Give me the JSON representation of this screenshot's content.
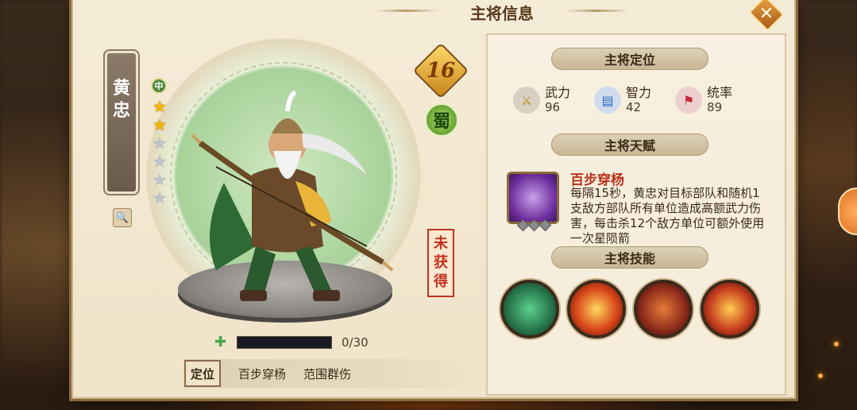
{
  "window": {
    "title": "主将信息"
  },
  "hero": {
    "name_chars": [
      "黄",
      "忠"
    ],
    "rank": "中",
    "stars_total": 6,
    "stars_filled": 2,
    "level": "16",
    "faction": "蜀",
    "status_chars": [
      "未",
      "获",
      "得"
    ],
    "fragments": {
      "current": 0,
      "max": 30,
      "text": "0/30"
    }
  },
  "tags": {
    "label": "定位",
    "items": [
      "百步穿杨",
      "范围群伤"
    ]
  },
  "sections": {
    "position": "主将定位",
    "talent": "主将天赋",
    "skills": "主将技能"
  },
  "stats": [
    {
      "key": "武力",
      "value": "96",
      "icon": "crossed-swords-icon"
    },
    {
      "key": "智力",
      "value": "42",
      "icon": "scroll-icon"
    },
    {
      "key": "统率",
      "value": "89",
      "icon": "banner-icon"
    }
  ],
  "talent": {
    "name": "百步穿杨",
    "description": "每隔15秒，黄忠对目标部队和随机1支敌方部队所有单位造成高额武力伤害，每击杀12个敌方单位可额外使用一次星陨箭"
  },
  "skills": [
    {
      "icon": "rune-slash-skill-icon"
    },
    {
      "icon": "lightning-skill-icon"
    },
    {
      "icon": "warrior-skill-icon"
    },
    {
      "icon": "flaming-arrow-skill-icon"
    }
  ],
  "colors": {
    "accent": "#b8321a",
    "panel": "#f5ecd8",
    "star": "#f2b800"
  }
}
